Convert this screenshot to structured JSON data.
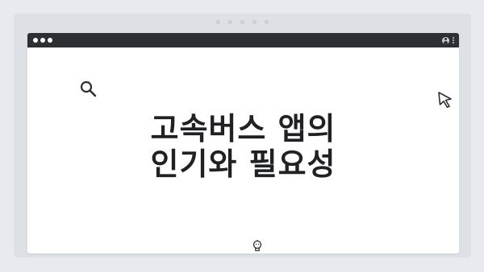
{
  "window": {
    "title_lines": [
      "고속버스 앱의",
      "인기와 필요성"
    ]
  },
  "icons": {
    "search": "search-icon",
    "cursor": "cursor-icon",
    "bulb": "lightbulb-icon",
    "user": "user-icon",
    "menu": "kebab-menu-icon"
  },
  "colors": {
    "titlebar": "#2d2f33",
    "background": "#e7eaee",
    "heading": "#1f2124"
  }
}
